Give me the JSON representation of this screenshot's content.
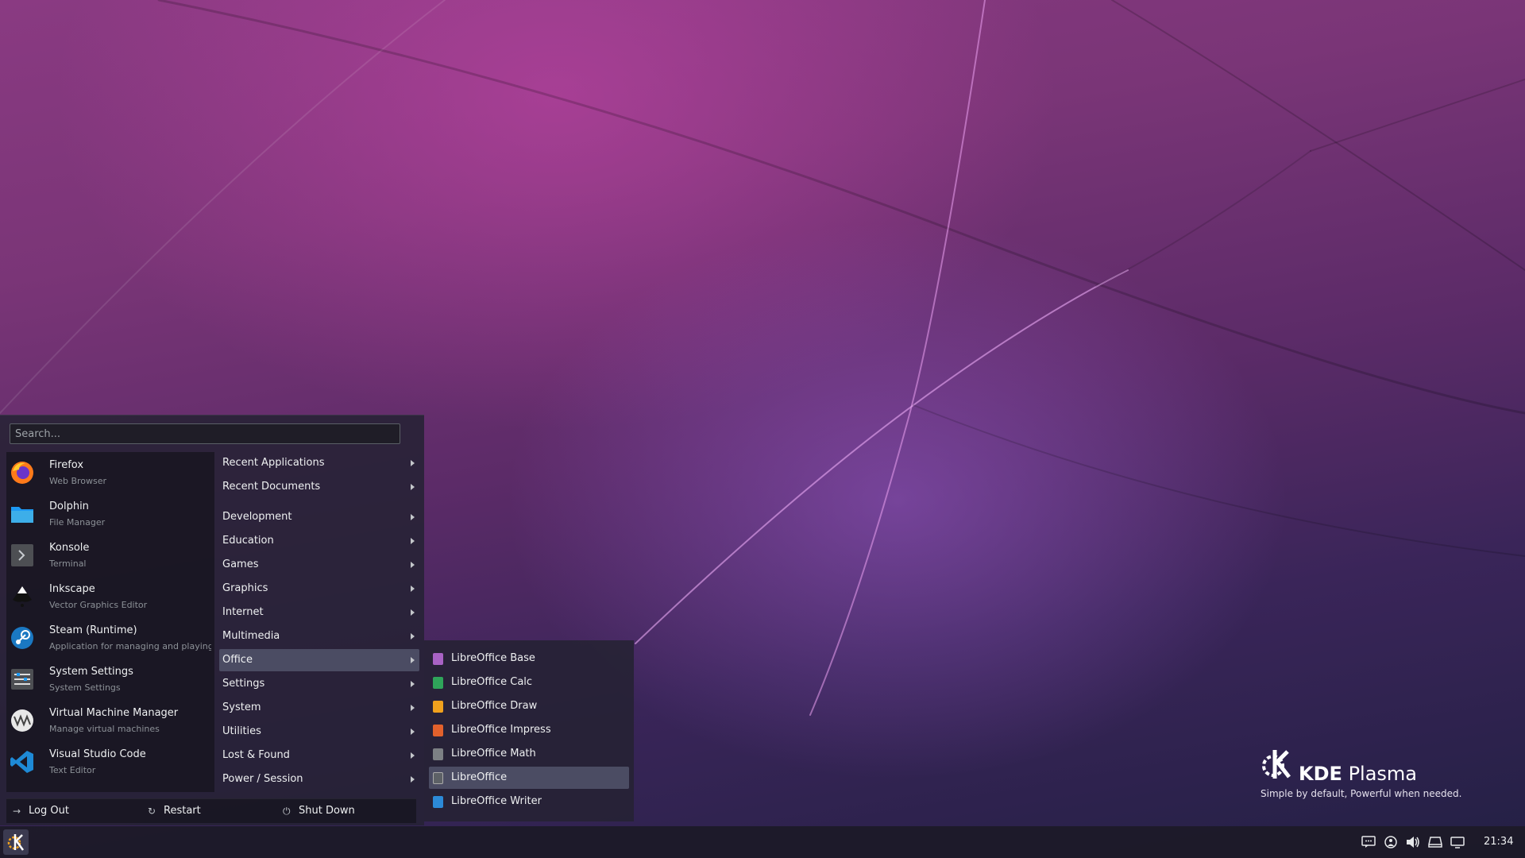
{
  "search": {
    "placeholder": "Search..."
  },
  "favorites": [
    {
      "name": "Firefox",
      "desc": "Web Browser",
      "icon": "firefox-icon"
    },
    {
      "name": "Dolphin",
      "desc": "File Manager",
      "icon": "folder-icon"
    },
    {
      "name": "Konsole",
      "desc": "Terminal",
      "icon": "terminal-icon"
    },
    {
      "name": "Inkscape",
      "desc": "Vector Graphics Editor",
      "icon": "inkscape-icon"
    },
    {
      "name": "Steam (Runtime)",
      "desc": "Application for managing and playing",
      "icon": "steam-icon"
    },
    {
      "name": "System Settings",
      "desc": "System Settings",
      "icon": "settings-icon"
    },
    {
      "name": "Virtual Machine Manager",
      "desc": "Manage virtual machines",
      "icon": "vm-icon"
    },
    {
      "name": "Visual Studio Code",
      "desc": "Text Editor",
      "icon": "vscode-icon"
    }
  ],
  "categories": [
    "Recent Applications",
    "Recent Documents",
    "Development",
    "Education",
    "Games",
    "Graphics",
    "Internet",
    "Multimedia",
    "Office",
    "Settings",
    "System",
    "Utilities",
    "Lost & Found",
    "Power / Session"
  ],
  "active_category": "Office",
  "power": {
    "logout": "Log Out",
    "restart": "Restart",
    "shutdown": "Shut Down"
  },
  "office_apps": [
    {
      "name": "LibreOffice Base",
      "color": "#a862c4"
    },
    {
      "name": "LibreOffice Calc",
      "color": "#2fa45a"
    },
    {
      "name": "LibreOffice Draw",
      "color": "#f0a11d"
    },
    {
      "name": "LibreOffice Impress",
      "color": "#e2612c"
    },
    {
      "name": "LibreOffice Math",
      "color": "#7c8084"
    },
    {
      "name": "LibreOffice",
      "color": "#5d6166"
    },
    {
      "name": "LibreOffice Writer",
      "color": "#2c8ad8"
    }
  ],
  "active_app": "LibreOffice",
  "brand": {
    "kde": "KDE",
    "plasma": "Plasma",
    "tagline": "Simple by default, Powerful when needed."
  },
  "clock": "21:34",
  "tray_icons": [
    "notes-icon",
    "network-icon",
    "volume-icon",
    "storage-icon",
    "display-icon"
  ]
}
